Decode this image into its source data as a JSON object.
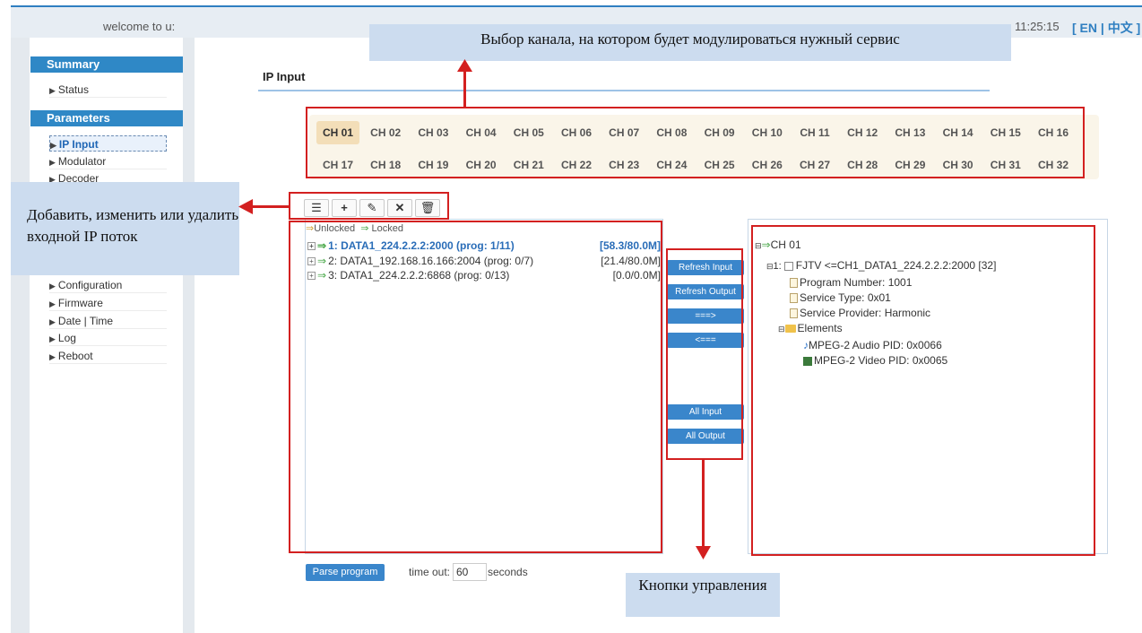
{
  "header": {
    "welcome": "welcome to u:",
    "clock": "11:25:15",
    "language": "[ EN | 中文 ]"
  },
  "sidebar": {
    "summary_heading": "Summary",
    "status": "Status",
    "parameters_heading": "Parameters",
    "items": [
      "IP Input",
      "Modulator",
      "Decoder",
      "Configuration",
      "Firmware",
      "Date | Time",
      "Log",
      "Reboot"
    ]
  },
  "main": {
    "page_title": "IP Input",
    "channels": [
      "CH 01",
      "CH 02",
      "CH 03",
      "CH 04",
      "CH 05",
      "CH 06",
      "CH 07",
      "CH 08",
      "CH 09",
      "CH 10",
      "CH 11",
      "CH 12",
      "CH 13",
      "CH 14",
      "CH 15",
      "CH 16",
      "CH 17",
      "CH 18",
      "CH 19",
      "CH 20",
      "CH 21",
      "CH 22",
      "CH 23",
      "CH 24",
      "CH 25",
      "CH 26",
      "CH 27",
      "CH 28",
      "CH 29",
      "CH 30",
      "CH 31",
      "CH 32"
    ],
    "selected_channel": "CH 01",
    "legend_unlocked": "Unlocked",
    "legend_locked": "Locked",
    "streams": [
      {
        "label": "1: DATA1_224.2.2.2:2000 (prog: 1/11)",
        "rate": "[58.3/80.0M]"
      },
      {
        "label": "2: DATA1_192.168.16.166:2004 (prog: 0/7)",
        "rate": "[21.4/80.0M]"
      },
      {
        "label": "3: DATA1_224.2.2.2:6868 (prog: 0/13)",
        "rate": "[0.0/0.0M]"
      }
    ],
    "buttons": {
      "refresh_input": "Refresh Input",
      "refresh_output": "Refresh Output",
      "move_right": "===>",
      "move_left": "<===",
      "all_input": "All Input",
      "all_output": "All Output"
    },
    "tree": {
      "root": "CH 01",
      "service_prefix": "1:",
      "service": "FJTV <=CH1_DATA1_224.2.2.2:2000 [32]",
      "program_number": "Program Number: 1001",
      "service_type": "Service Type: 0x01",
      "service_provider": "Service Provider: Harmonic",
      "elements": "Elements",
      "audio": "MPEG-2 Audio PID: 0x0066",
      "video": "MPEG-2 Video PID: 0x0065"
    },
    "parse_button": "Parse program",
    "timeout_label": "time out:",
    "timeout_value": "60",
    "seconds_label": "seconds"
  },
  "annotations": {
    "channel_select": "Выбор канала, на котором будет модулироваться нужный сервис",
    "stream_edit": "Добавить, изменить или удалить входной IP поток",
    "control_buttons": "Кнопки управления"
  },
  "icons": [
    "list-icon",
    "plus-icon",
    "pencil-icon",
    "close-icon",
    "trash-icon"
  ],
  "colors": {
    "accent": "#2f88c6",
    "annotation_red": "#d32020",
    "callout_bg": "#ccdcef",
    "locked_green": "#4aa84a"
  }
}
